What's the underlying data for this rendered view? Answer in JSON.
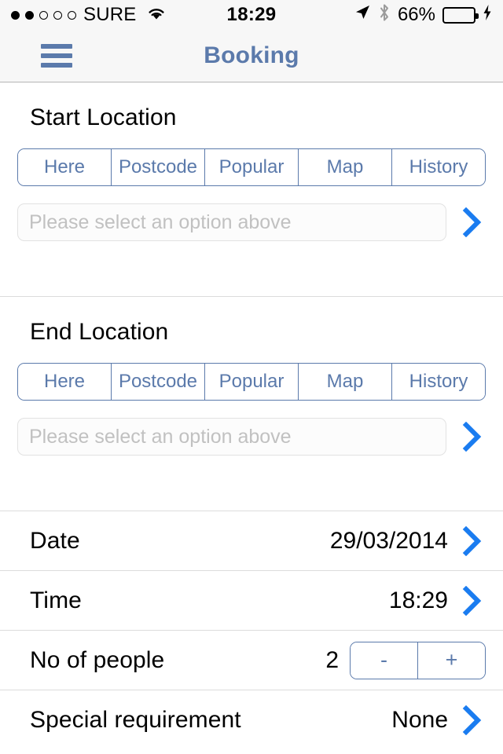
{
  "status_bar": {
    "signal_dots_total": 5,
    "signal_dots_filled": 2,
    "carrier": "SURE",
    "wifi_icon": "wifi-icon",
    "time": "18:29",
    "location_icon": "location-arrow-icon",
    "bluetooth_icon": "bluetooth-icon",
    "battery_percent": "66%",
    "battery_level": 66,
    "battery_color": "#3ad63a",
    "charging": true
  },
  "navbar": {
    "menu_icon": "hamburger-menu-icon",
    "title": "Booking",
    "title_color": "#5b7aab",
    "background": "#f7f7f7"
  },
  "accent_blue": "#1a7cf0",
  "sections": [
    {
      "title": "Start Location",
      "segments": [
        "Here",
        "Postcode",
        "Popular",
        "Map",
        "History"
      ],
      "input": {
        "value": "",
        "placeholder": "Please select an option above"
      },
      "chevron_icon": "chevron-right-icon"
    },
    {
      "title": "End Location",
      "segments": [
        "Here",
        "Postcode",
        "Popular",
        "Map",
        "History"
      ],
      "input": {
        "value": "",
        "placeholder": "Please select an option above"
      },
      "chevron_icon": "chevron-right-icon"
    }
  ],
  "rows": [
    {
      "label": "Date",
      "value": "29/03/2014",
      "chevron_icon": "chevron-right-icon"
    },
    {
      "label": "Time",
      "value": "18:29",
      "chevron_icon": "chevron-right-icon"
    },
    {
      "label": "No of people",
      "value": "2",
      "minus_label": "-",
      "plus_label": "+"
    },
    {
      "label": "Special requirement",
      "value": "None",
      "chevron_icon": "chevron-right-icon"
    }
  ]
}
